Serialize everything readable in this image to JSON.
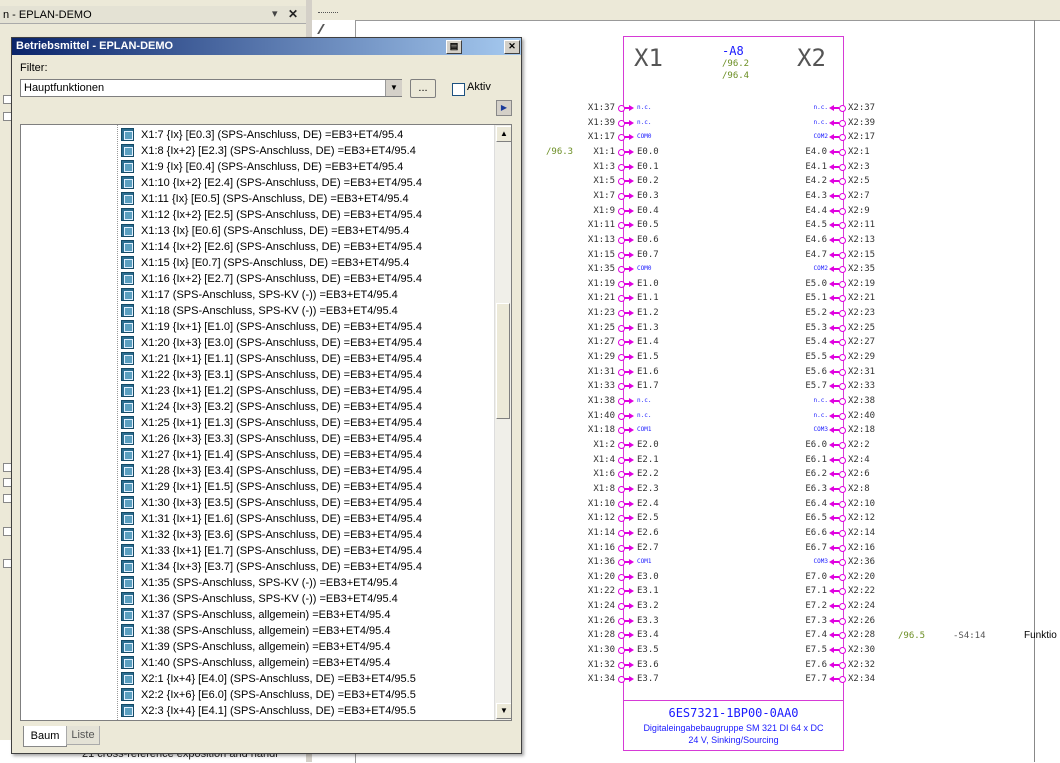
{
  "background_panel": {
    "title": "n - EPLAN-DEMO",
    "bottom_text": "21 cross-reference exposition and handl"
  },
  "dialog": {
    "title": "Betriebsmittel - EPLAN-DEMO",
    "filter_label": "Filter:",
    "filter_value": "Hauptfunktionen",
    "dots_button": "...",
    "aktiv_label": "Aktiv",
    "tabs": [
      "Baum",
      "Liste"
    ],
    "active_tab": "Baum",
    "tree_items": [
      "X1:7 {Ix} [E0.3] (SPS-Anschluss, DE) =EB3+ET4/95.4",
      "X1:8 {Ix+2} [E2.3] (SPS-Anschluss, DE) =EB3+ET4/95.4",
      "X1:9 {Ix} [E0.4] (SPS-Anschluss, DE) =EB3+ET4/95.4",
      "X1:10 {Ix+2} [E2.4] (SPS-Anschluss, DE) =EB3+ET4/95.4",
      "X1:11 {Ix} [E0.5] (SPS-Anschluss, DE) =EB3+ET4/95.4",
      "X1:12 {Ix+2} [E2.5] (SPS-Anschluss, DE) =EB3+ET4/95.4",
      "X1:13 {Ix} [E0.6] (SPS-Anschluss, DE) =EB3+ET4/95.4",
      "X1:14 {Ix+2} [E2.6] (SPS-Anschluss, DE) =EB3+ET4/95.4",
      "X1:15 {Ix} [E0.7] (SPS-Anschluss, DE) =EB3+ET4/95.4",
      "X1:16 {Ix+2} [E2.7] (SPS-Anschluss, DE) =EB3+ET4/95.4",
      "X1:17 (SPS-Anschluss, SPS-KV (-)) =EB3+ET4/95.4",
      "X1:18 (SPS-Anschluss, SPS-KV (-)) =EB3+ET4/95.4",
      "X1:19 {Ix+1} [E1.0] (SPS-Anschluss, DE) =EB3+ET4/95.4",
      "X1:20 {Ix+3} [E3.0] (SPS-Anschluss, DE) =EB3+ET4/95.4",
      "X1:21 {Ix+1} [E1.1] (SPS-Anschluss, DE) =EB3+ET4/95.4",
      "X1:22 {Ix+3} [E3.1] (SPS-Anschluss, DE) =EB3+ET4/95.4",
      "X1:23 {Ix+1} [E1.2] (SPS-Anschluss, DE) =EB3+ET4/95.4",
      "X1:24 {Ix+3} [E3.2] (SPS-Anschluss, DE) =EB3+ET4/95.4",
      "X1:25 {Ix+1} [E1.3] (SPS-Anschluss, DE) =EB3+ET4/95.4",
      "X1:26 {Ix+3} [E3.3] (SPS-Anschluss, DE) =EB3+ET4/95.4",
      "X1:27 {Ix+1} [E1.4] (SPS-Anschluss, DE) =EB3+ET4/95.4",
      "X1:28 {Ix+3} [E3.4] (SPS-Anschluss, DE) =EB3+ET4/95.4",
      "X1:29 {Ix+1} [E1.5] (SPS-Anschluss, DE) =EB3+ET4/95.4",
      "X1:30 {Ix+3} [E3.5] (SPS-Anschluss, DE) =EB3+ET4/95.4",
      "X1:31 {Ix+1} [E1.6] (SPS-Anschluss, DE) =EB3+ET4/95.4",
      "X1:32 {Ix+3} [E3.6] (SPS-Anschluss, DE) =EB3+ET4/95.4",
      "X1:33 {Ix+1} [E1.7] (SPS-Anschluss, DE) =EB3+ET4/95.4",
      "X1:34 {Ix+3} [E3.7] (SPS-Anschluss, DE) =EB3+ET4/95.4",
      "X1:35 (SPS-Anschluss, SPS-KV (-)) =EB3+ET4/95.4",
      "X1:36 (SPS-Anschluss, SPS-KV (-)) =EB3+ET4/95.4",
      "X1:37 (SPS-Anschluss, allgemein) =EB3+ET4/95.4",
      "X1:38 (SPS-Anschluss, allgemein) =EB3+ET4/95.4",
      "X1:39 (SPS-Anschluss, allgemein) =EB3+ET4/95.4",
      "X1:40 (SPS-Anschluss, allgemein) =EB3+ET4/95.4",
      "X2:1 {Ix+4} [E4.0] (SPS-Anschluss, DE) =EB3+ET4/95.5",
      "X2:2 {Ix+6} [E6.0] (SPS-Anschluss, DE) =EB3+ET4/95.5",
      "X2:3 {Ix+4} [E4.1] (SPS-Anschluss, DE) =EB3+ET4/95.5"
    ]
  },
  "schematic": {
    "module_left": "X1",
    "module_right": "X2",
    "device_tag": "-A8",
    "xref_1": "/96.2",
    "xref_2": "/96.4",
    "xref_left": "/96.3",
    "xref_right": "/96.5",
    "xref_right_2": "-S4:14",
    "right_cut_text": "Funktio",
    "part_number": "6ES7321-1BP00-0AA0",
    "description_1": "Digitaleingabebaugruppe SM 321 DI 64 x DC",
    "description_2": "24 V, Sinking/Sourcing",
    "left_pins": [
      {
        "pin": "X1:37",
        "sig": "n.c."
      },
      {
        "pin": "X1:39",
        "sig": "n.c."
      },
      {
        "pin": "X1:17",
        "sig": "COM0"
      },
      {
        "pin": "X1:1",
        "sig": "E0.0"
      },
      {
        "pin": "X1:3",
        "sig": "E0.1"
      },
      {
        "pin": "X1:5",
        "sig": "E0.2"
      },
      {
        "pin": "X1:7",
        "sig": "E0.3"
      },
      {
        "pin": "X1:9",
        "sig": "E0.4"
      },
      {
        "pin": "X1:11",
        "sig": "E0.5"
      },
      {
        "pin": "X1:13",
        "sig": "E0.6"
      },
      {
        "pin": "X1:15",
        "sig": "E0.7"
      },
      {
        "pin": "X1:35",
        "sig": "COM0"
      },
      {
        "pin": "X1:19",
        "sig": "E1.0"
      },
      {
        "pin": "X1:21",
        "sig": "E1.1"
      },
      {
        "pin": "X1:23",
        "sig": "E1.2"
      },
      {
        "pin": "X1:25",
        "sig": "E1.3"
      },
      {
        "pin": "X1:27",
        "sig": "E1.4"
      },
      {
        "pin": "X1:29",
        "sig": "E1.5"
      },
      {
        "pin": "X1:31",
        "sig": "E1.6"
      },
      {
        "pin": "X1:33",
        "sig": "E1.7"
      },
      {
        "pin": "X1:38",
        "sig": "n.c."
      },
      {
        "pin": "X1:40",
        "sig": "n.c."
      },
      {
        "pin": "X1:18",
        "sig": "COM1"
      },
      {
        "pin": "X1:2",
        "sig": "E2.0"
      },
      {
        "pin": "X1:4",
        "sig": "E2.1"
      },
      {
        "pin": "X1:6",
        "sig": "E2.2"
      },
      {
        "pin": "X1:8",
        "sig": "E2.3"
      },
      {
        "pin": "X1:10",
        "sig": "E2.4"
      },
      {
        "pin": "X1:12",
        "sig": "E2.5"
      },
      {
        "pin": "X1:14",
        "sig": "E2.6"
      },
      {
        "pin": "X1:16",
        "sig": "E2.7"
      },
      {
        "pin": "X1:36",
        "sig": "COM1"
      },
      {
        "pin": "X1:20",
        "sig": "E3.0"
      },
      {
        "pin": "X1:22",
        "sig": "E3.1"
      },
      {
        "pin": "X1:24",
        "sig": "E3.2"
      },
      {
        "pin": "X1:26",
        "sig": "E3.3"
      },
      {
        "pin": "X1:28",
        "sig": "E3.4"
      },
      {
        "pin": "X1:30",
        "sig": "E3.5"
      },
      {
        "pin": "X1:32",
        "sig": "E3.6"
      },
      {
        "pin": "X1:34",
        "sig": "E3.7"
      }
    ],
    "right_pins": [
      {
        "pin": "X2:37",
        "sig": "n.c."
      },
      {
        "pin": "X2:39",
        "sig": "n.c."
      },
      {
        "pin": "X2:17",
        "sig": "COM2"
      },
      {
        "pin": "X2:1",
        "sig": "E4.0"
      },
      {
        "pin": "X2:3",
        "sig": "E4.1"
      },
      {
        "pin": "X2:5",
        "sig": "E4.2"
      },
      {
        "pin": "X2:7",
        "sig": "E4.3"
      },
      {
        "pin": "X2:9",
        "sig": "E4.4"
      },
      {
        "pin": "X2:11",
        "sig": "E4.5"
      },
      {
        "pin": "X2:13",
        "sig": "E4.6"
      },
      {
        "pin": "X2:15",
        "sig": "E4.7"
      },
      {
        "pin": "X2:35",
        "sig": "COM2"
      },
      {
        "pin": "X2:19",
        "sig": "E5.0"
      },
      {
        "pin": "X2:21",
        "sig": "E5.1"
      },
      {
        "pin": "X2:23",
        "sig": "E5.2"
      },
      {
        "pin": "X2:25",
        "sig": "E5.3"
      },
      {
        "pin": "X2:27",
        "sig": "E5.4"
      },
      {
        "pin": "X2:29",
        "sig": "E5.5"
      },
      {
        "pin": "X2:31",
        "sig": "E5.6"
      },
      {
        "pin": "X2:33",
        "sig": "E5.7"
      },
      {
        "pin": "X2:38",
        "sig": "n.c."
      },
      {
        "pin": "X2:40",
        "sig": "n.c."
      },
      {
        "pin": "X2:18",
        "sig": "COM3"
      },
      {
        "pin": "X2:2",
        "sig": "E6.0"
      },
      {
        "pin": "X2:4",
        "sig": "E6.1"
      },
      {
        "pin": "X2:6",
        "sig": "E6.2"
      },
      {
        "pin": "X2:8",
        "sig": "E6.3"
      },
      {
        "pin": "X2:10",
        "sig": "E6.4"
      },
      {
        "pin": "X2:12",
        "sig": "E6.5"
      },
      {
        "pin": "X2:14",
        "sig": "E6.6"
      },
      {
        "pin": "X2:16",
        "sig": "E6.7"
      },
      {
        "pin": "X2:36",
        "sig": "COM3"
      },
      {
        "pin": "X2:20",
        "sig": "E7.0"
      },
      {
        "pin": "X2:22",
        "sig": "E7.1"
      },
      {
        "pin": "X2:24",
        "sig": "E7.2"
      },
      {
        "pin": "X2:26",
        "sig": "E7.3"
      },
      {
        "pin": "X2:28",
        "sig": "E7.4"
      },
      {
        "pin": "X2:30",
        "sig": "E7.5"
      },
      {
        "pin": "X2:32",
        "sig": "E7.6"
      },
      {
        "pin": "X2:34",
        "sig": "E7.7"
      }
    ]
  },
  "colors": {
    "schematic_magenta": "#e000e0",
    "xref_green": "#6b8e23",
    "tag_blue": "#1a1aff",
    "title_bar": "#0a246a"
  },
  "icons": [
    "tree-item-icon",
    "dialog-pin-icon",
    "dialog-close-icon",
    "dropdown-arrow-icon",
    "scroll-up-icon",
    "scroll-down-icon",
    "play-icon"
  ]
}
